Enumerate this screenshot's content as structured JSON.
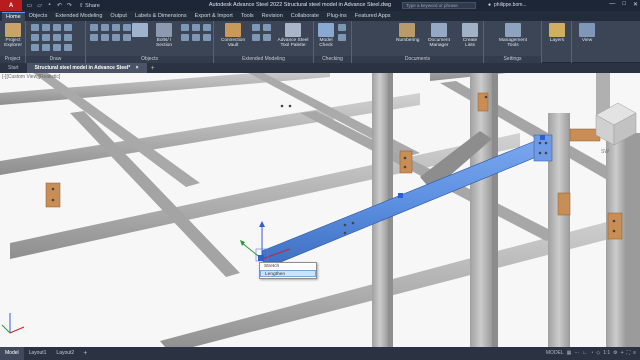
{
  "titlebar": {
    "logo": "A",
    "share": "Share",
    "title": "Autodesk Advance Steel 2022   Structural steel model in Advance Steel.dwg",
    "search_placeholder": "Type a keyword or phrase",
    "user": "philippe.bom...",
    "min": "—",
    "max": "□",
    "close": "✕"
  },
  "ribbon_tabs": [
    "Home",
    "Objects",
    "Extended Modeling",
    "Output",
    "Labels & Dimensions",
    "Export & Import",
    "Tools",
    "Revision",
    "Collaborate",
    "Plug-ins",
    "Featured Apps"
  ],
  "ribbon": {
    "project": {
      "title": "Project",
      "btn": "Project Explorer"
    },
    "draw": {
      "title": "Draw"
    },
    "objects": {
      "title": "Objects",
      "bolts": "Bolts/ I Section"
    },
    "connection": {
      "btn": "Connection Vault"
    },
    "extended": {
      "title": "Extended Modeling",
      "tool_palette": "Advance Steel Tool Palette"
    },
    "checking": {
      "title": "Checking",
      "model_check": "Model Check"
    },
    "documents": {
      "title": "Documents",
      "numbering": "Numbering",
      "doc_manager": "Document Manager",
      "create_lists": "Create Lists"
    },
    "settings": {
      "title": "Settings",
      "mgmt_tools": "Management Tools"
    },
    "layers": {
      "btn": "Layers"
    },
    "view": {
      "btn": "View"
    }
  },
  "doc_tabs": {
    "start": "Start",
    "active": "Structural steel model in Advance Steel*",
    "close": "×",
    "plus": "+"
  },
  "viewport": {
    "label": "[-][Custom View][Realistic]",
    "viewcube_label": "SW"
  },
  "context_menu": {
    "items": [
      "Stretch",
      "Lengthen"
    ]
  },
  "status": {
    "tabs": [
      "Model",
      "Layout1",
      "Layout2"
    ],
    "model_label": "MODEL",
    "scale": "1:1"
  },
  "colors": {
    "accent": "#5c9be8",
    "selected_beam": "#5b8fe0",
    "steel": "#b4b4b4"
  }
}
